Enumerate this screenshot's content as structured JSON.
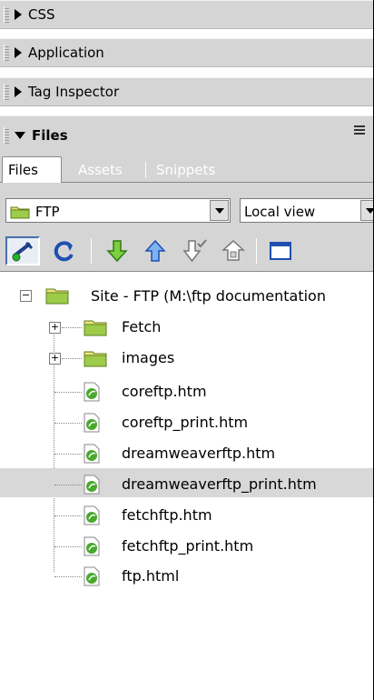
{
  "panels": {
    "css": {
      "label": "CSS",
      "state": "collapsed"
    },
    "application": {
      "label": "Application",
      "state": "collapsed"
    },
    "tag_inspector": {
      "label": "Tag Inspector",
      "state": "collapsed"
    },
    "files": {
      "label": "Files",
      "state": "expanded"
    }
  },
  "tabs": [
    {
      "label": "Files",
      "active": true
    },
    {
      "label": "Assets",
      "active": false
    },
    {
      "label": "Snippets",
      "active": false
    }
  ],
  "site_select": {
    "value": "FTP"
  },
  "view_select": {
    "value": "Local view"
  },
  "toolbar": {
    "buttons": [
      "connect-icon",
      "refresh-icon",
      "get-icon",
      "put-icon",
      "check-out-icon",
      "check-in-icon",
      "expand-icon"
    ]
  },
  "tree": {
    "root": {
      "label": "Site - FTP (M:\\ftp documentation"
    },
    "folders": [
      "Fetch",
      "images"
    ],
    "files": [
      "coreftp.htm",
      "coreftp_print.htm",
      "dreamweaverftp.htm",
      "dreamweaverftp_print.htm",
      "fetchftp.htm",
      "fetchftp_print.htm",
      "ftp.html"
    ],
    "selected": "dreamweaverftp_print.htm"
  },
  "colors": {
    "panel_bg": "#d5d5d5",
    "selected_row": "#d8d8d8",
    "folder_green": "#5f9a2c",
    "arrow_green": "#4c9a1e",
    "arrow_blue": "#2f6fcc"
  }
}
